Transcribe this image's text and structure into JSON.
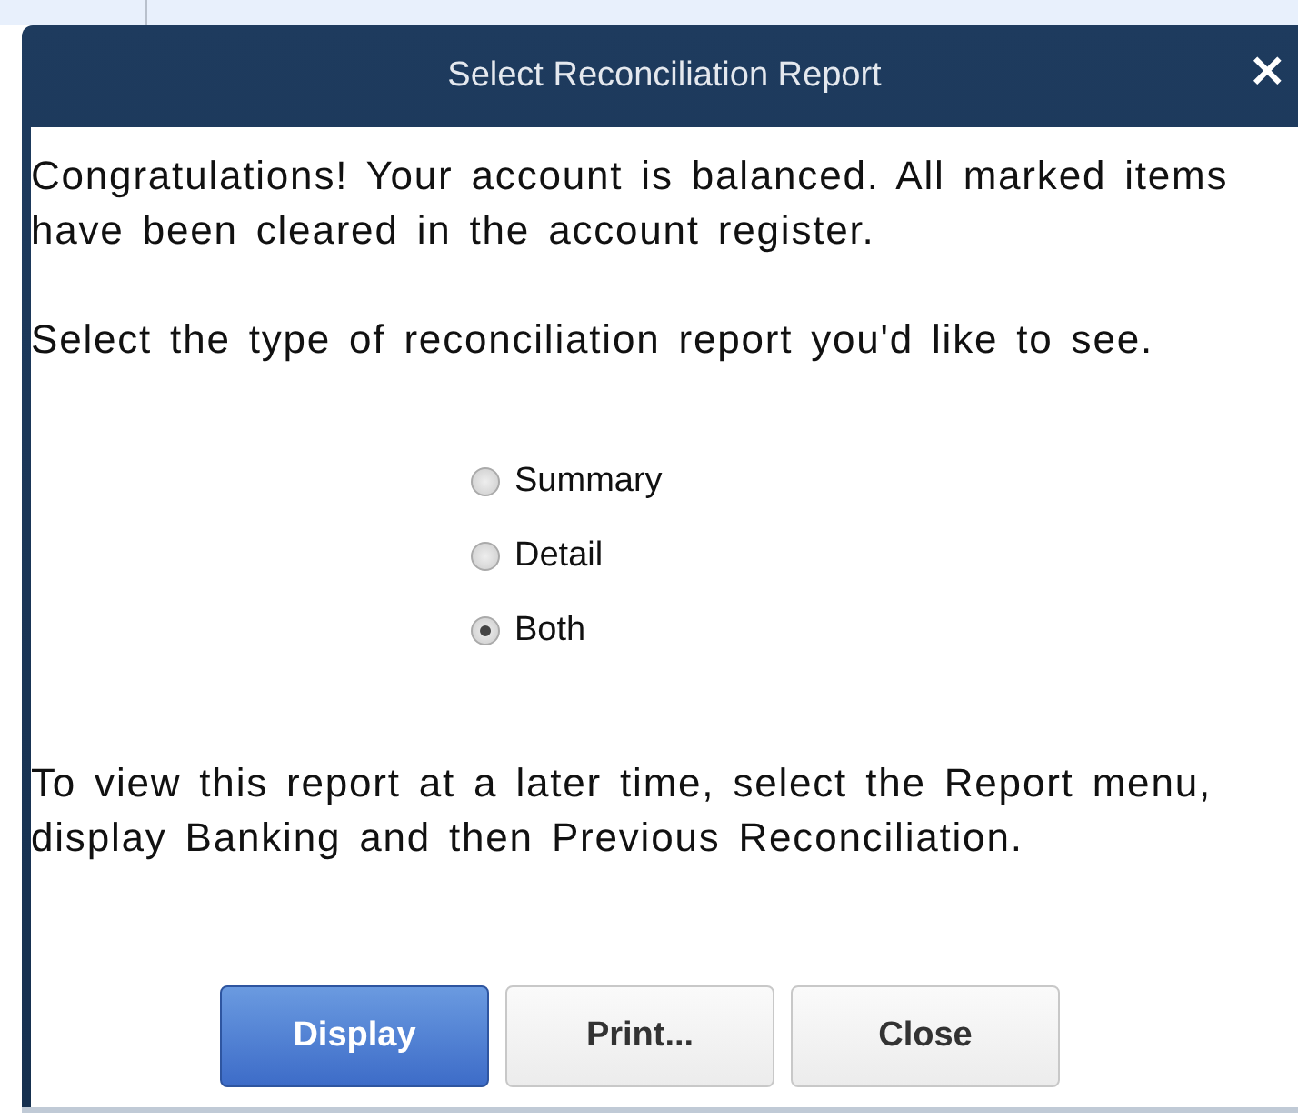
{
  "window": {
    "title": "Select Reconciliation Report",
    "close": "×"
  },
  "message": "Congratulations! Your account is balanced. All marked items have been cleared in the account register.",
  "prompt": "Select the type of reconciliation report you'd like to see.",
  "options": [
    {
      "label": "Summary",
      "selected": false
    },
    {
      "label": "Detail",
      "selected": false
    },
    {
      "label": "Both",
      "selected": true
    }
  ],
  "note": "To view this report at a later time, select the Report menu, display Banking and then Previous Reconciliation.",
  "buttons": [
    {
      "label": "Display",
      "kind": "primary"
    },
    {
      "label": "Print...",
      "kind": "normal"
    },
    {
      "label": "Close",
      "kind": "normal"
    }
  ]
}
